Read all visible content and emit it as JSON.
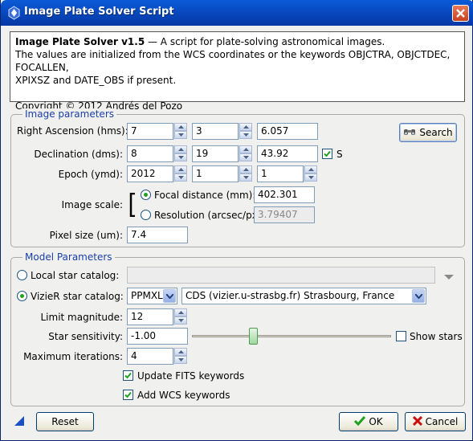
{
  "window": {
    "title": "Image Plate Solver Script"
  },
  "info": {
    "heading": "Image Plate Solver v1.5",
    "heading_suffix": " — A script for plate-solving astronomical images.",
    "line2": "The values are initialized from the WCS coordinates or the keywords OBJCTRA, OBJCTDEC, FOCALLEN,",
    "line3": "XPIXSZ and DATE_OBS if present.",
    "copyright": "Copyright © 2012 Andrés del Pozo"
  },
  "image_params": {
    "legend": "Image parameters",
    "ra_label": "Right Ascension (hms):",
    "ra_h": "7",
    "ra_m": "3",
    "ra_s": "6.057",
    "search_label": "Search",
    "dec_label": "Declination (dms):",
    "dec_d": "8",
    "dec_m": "19",
    "dec_s": "43.92",
    "south_label": "S",
    "epoch_label": "Epoch (ymd):",
    "epoch_y": "2012",
    "epoch_m": "1",
    "epoch_d": "1",
    "scale_label": "Image scale:",
    "focal_label": "Focal distance (mm):",
    "focal_value": "402.301",
    "resolution_label": "Resolution (arcsec/px):",
    "resolution_value": "3.79407",
    "pixel_label": "Pixel size (um):",
    "pixel_value": "7.4"
  },
  "model_params": {
    "legend": "Model Parameters",
    "local_label": "Local star catalog:",
    "local_value": "",
    "vizier_label": "VizieR star catalog:",
    "catalog_value": "PPMXL",
    "server_value": "CDS (vizier.u-strasbg.fr) Strasbourg, France",
    "limit_label": "Limit magnitude:",
    "limit_value": "12",
    "sensitivity_label": "Star sensitivity:",
    "sensitivity_value": "-1.00",
    "sensitivity_level": 0.3,
    "show_stars_label": "Show stars",
    "iterations_label": "Maximum iterations:",
    "iterations_value": "4",
    "update_fits_label": "Update FITS keywords",
    "add_wcs_label": "Add WCS keywords"
  },
  "footer": {
    "reset_label": "Reset",
    "ok_label": "OK",
    "cancel_label": "Cancel"
  },
  "colors": {
    "title_bar": "#0744b8",
    "legend_text": "#1a3fa8",
    "radio_dot": "#21a121",
    "check_green": "#21a121",
    "cancel_red": "#cc1010"
  }
}
